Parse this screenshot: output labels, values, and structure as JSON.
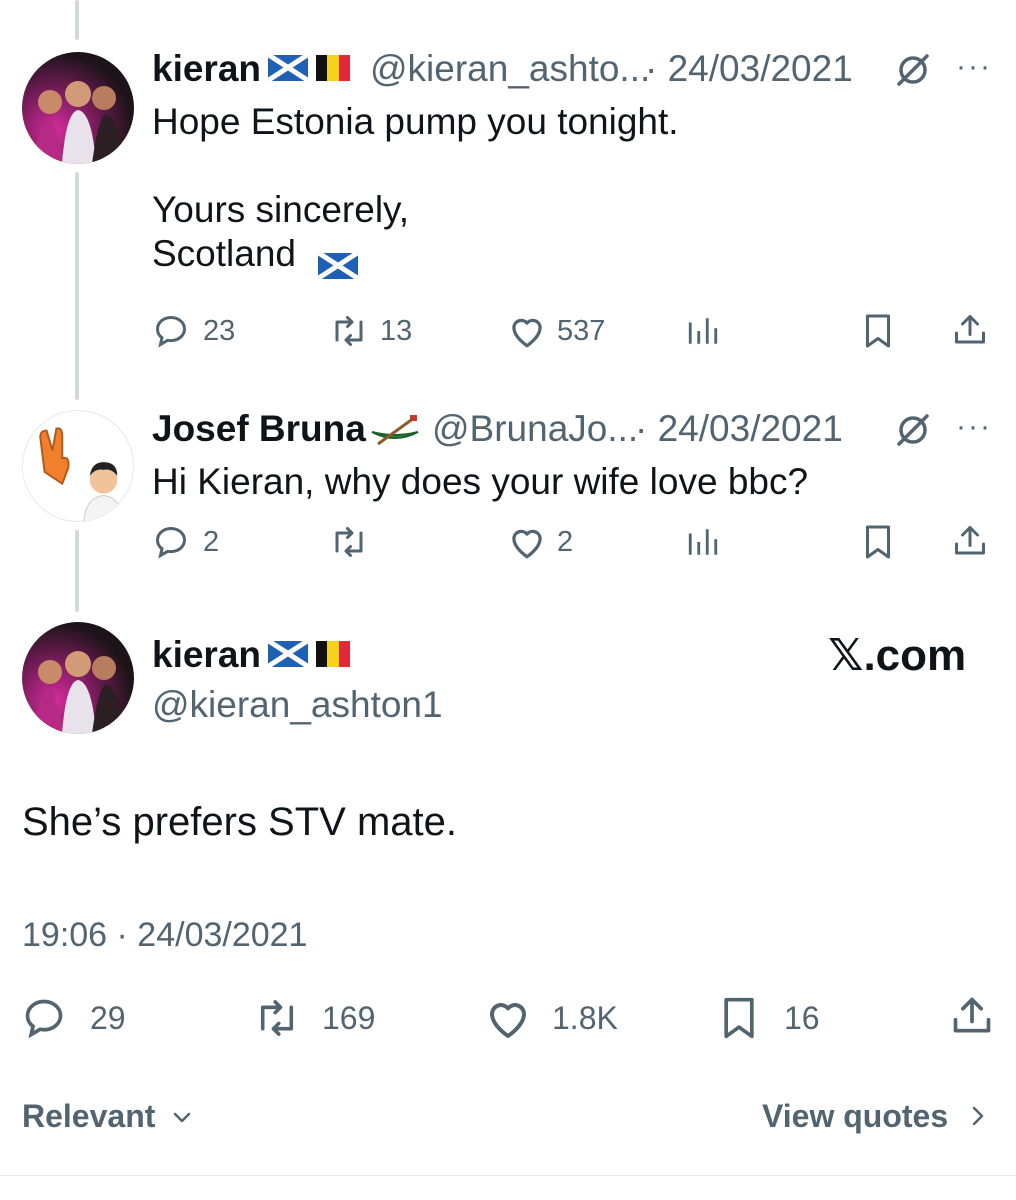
{
  "tweets": [
    {
      "name": "kieran",
      "handle": "@kieran_ashto...",
      "date": "· 24/03/2021",
      "text": "Hope Estonia pump you tonight.\n\nYours sincerely,\nScotland",
      "replies": "23",
      "reposts": "13",
      "likes": "537"
    },
    {
      "name": "Josef Bruna",
      "handle": "@BrunaJo...",
      "date": "· 24/03/2021",
      "text": "Hi Kieran, why does your wife love bbc?",
      "replies": "2",
      "reposts": "",
      "likes": "2"
    }
  ],
  "main": {
    "name": "kieran",
    "handle": "@kieran_ashton1",
    "text": "She’s prefers STV mate.",
    "timestamp": "19:06 · 24/03/2021",
    "replies": "29",
    "reposts": "169",
    "likes": "1.8K",
    "bookmarks": "16",
    "watermark": "𝕏.com"
  },
  "footer": {
    "relevant": "Relevant",
    "view_quotes": "View quotes"
  },
  "more_glyph": "···",
  "colors": {
    "text": "#0f1419",
    "secondary": "#536471",
    "thread_line": "#cfd9de",
    "scotland_blue": "#1f5fb4"
  }
}
